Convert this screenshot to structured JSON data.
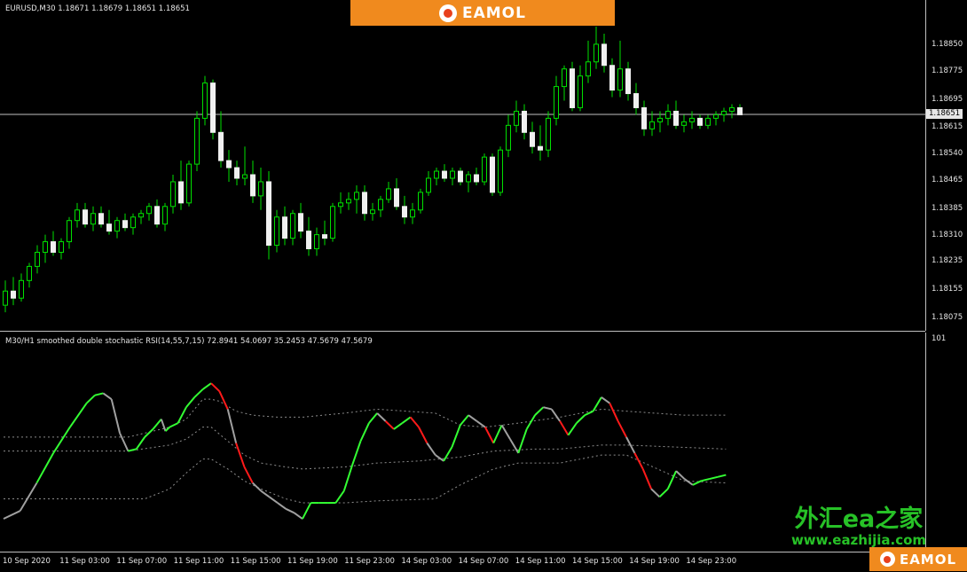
{
  "symbol_header": "EURUSD,M30  1.18671 1.18679 1.18651 1.18651",
  "indicator_header": "M30/H1 smoothed double stochastic RSI(14,55,7,15) 72.8941 54.0697 35.2453 47.5679 47.5679",
  "price_axis": {
    "ticks": [
      "1.18850",
      "1.18775",
      "1.18695",
      "1.18615",
      "1.18540",
      "1.18465",
      "1.18385",
      "1.18310",
      "1.18235",
      "1.18155",
      "1.18075"
    ],
    "current_price": "1.18651"
  },
  "indicator_axis": {
    "top_label": "101"
  },
  "time_axis": {
    "labels": [
      "10 Sep 2020",
      "11 Sep 03:00",
      "11 Sep 07:00",
      "11 Sep 11:00",
      "11 Sep 15:00",
      "11 Sep 19:00",
      "11 Sep 23:00",
      "14 Sep 03:00",
      "14 Sep 07:00",
      "14 Sep 11:00",
      "14 Sep 15:00",
      "14 Sep 19:00",
      "14 Sep 23:00"
    ]
  },
  "brand": {
    "top": "EAMOL",
    "bottom": "EAMOL"
  },
  "watermark": {
    "cn": "外汇ea之家",
    "url": "www.eazhijia.com"
  },
  "colors": {
    "bull": "#00e000",
    "bear": "#f0f0f0",
    "rising": "#33ff33",
    "falling": "#ff1a1a",
    "neutral": "#a0a0a0",
    "band": "#8c8c8c",
    "brand": "#f08a1e"
  },
  "chart_data": [
    {
      "type": "candlestick",
      "title": "EURUSD,M30",
      "ylim": [
        1.1805,
        1.189
      ],
      "candles": [
        [
          1.1811,
          1.1818,
          1.1809,
          1.1815
        ],
        [
          1.1815,
          1.1819,
          1.1811,
          1.1813
        ],
        [
          1.1813,
          1.182,
          1.1812,
          1.1818
        ],
        [
          1.1818,
          1.1823,
          1.1816,
          1.1822
        ],
        [
          1.1822,
          1.1828,
          1.182,
          1.1826
        ],
        [
          1.1826,
          1.1831,
          1.1823,
          1.1829
        ],
        [
          1.1829,
          1.1832,
          1.1825,
          1.1826
        ],
        [
          1.1826,
          1.183,
          1.1824,
          1.1829
        ],
        [
          1.1829,
          1.1836,
          1.1827,
          1.1835
        ],
        [
          1.1835,
          1.184,
          1.1833,
          1.1838
        ],
        [
          1.1838,
          1.184,
          1.1833,
          1.1834
        ],
        [
          1.1834,
          1.1839,
          1.1832,
          1.1837
        ],
        [
          1.1837,
          1.1839,
          1.1833,
          1.1834
        ],
        [
          1.1834,
          1.1838,
          1.1831,
          1.1832
        ],
        [
          1.1832,
          1.1836,
          1.183,
          1.1835
        ],
        [
          1.1835,
          1.1837,
          1.1832,
          1.1833
        ],
        [
          1.1833,
          1.1837,
          1.1831,
          1.1836
        ],
        [
          1.1836,
          1.1838,
          1.1834,
          1.1837
        ],
        [
          1.1837,
          1.184,
          1.1835,
          1.1839
        ],
        [
          1.1839,
          1.1841,
          1.1833,
          1.1834
        ],
        [
          1.1834,
          1.184,
          1.1832,
          1.1839
        ],
        [
          1.1839,
          1.1848,
          1.1837,
          1.1846
        ],
        [
          1.1846,
          1.1852,
          1.1838,
          1.184
        ],
        [
          1.184,
          1.1852,
          1.1839,
          1.1851
        ],
        [
          1.1851,
          1.1866,
          1.1849,
          1.1864
        ],
        [
          1.1864,
          1.1876,
          1.1862,
          1.1874
        ],
        [
          1.1874,
          1.1875,
          1.1858,
          1.186
        ],
        [
          1.186,
          1.1866,
          1.185,
          1.1852
        ],
        [
          1.1852,
          1.1855,
          1.1846,
          1.185
        ],
        [
          1.185,
          1.1852,
          1.1845,
          1.1847
        ],
        [
          1.1847,
          1.1856,
          1.1845,
          1.1848
        ],
        [
          1.1848,
          1.1852,
          1.184,
          1.1842
        ],
        [
          1.1842,
          1.185,
          1.1838,
          1.1846
        ],
        [
          1.1846,
          1.1849,
          1.1824,
          1.1828
        ],
        [
          1.1828,
          1.1838,
          1.1826,
          1.1836
        ],
        [
          1.1836,
          1.1839,
          1.1828,
          1.183
        ],
        [
          1.183,
          1.1838,
          1.1828,
          1.1837
        ],
        [
          1.1837,
          1.184,
          1.183,
          1.1832
        ],
        [
          1.1832,
          1.1836,
          1.1825,
          1.1827
        ],
        [
          1.1827,
          1.1833,
          1.1825,
          1.1831
        ],
        [
          1.1831,
          1.1835,
          1.1828,
          1.183
        ],
        [
          1.183,
          1.184,
          1.1829,
          1.1839
        ],
        [
          1.1839,
          1.1843,
          1.1837,
          1.184
        ],
        [
          1.184,
          1.1843,
          1.1838,
          1.1841
        ],
        [
          1.1841,
          1.1845,
          1.1837,
          1.1843
        ],
        [
          1.1843,
          1.1845,
          1.1835,
          1.1837
        ],
        [
          1.1837,
          1.184,
          1.1835,
          1.1838
        ],
        [
          1.1838,
          1.1842,
          1.1836,
          1.1841
        ],
        [
          1.1841,
          1.1846,
          1.184,
          1.1844
        ],
        [
          1.1844,
          1.1847,
          1.1838,
          1.1839
        ],
        [
          1.1839,
          1.1842,
          1.1834,
          1.1836
        ],
        [
          1.1836,
          1.184,
          1.1834,
          1.1838
        ],
        [
          1.1838,
          1.1844,
          1.1837,
          1.1843
        ],
        [
          1.1843,
          1.1849,
          1.1842,
          1.1847
        ],
        [
          1.1847,
          1.185,
          1.1845,
          1.1849
        ],
        [
          1.1849,
          1.1851,
          1.1846,
          1.1847
        ],
        [
          1.1847,
          1.185,
          1.1845,
          1.1849
        ],
        [
          1.1849,
          1.185,
          1.1845,
          1.1846
        ],
        [
          1.1846,
          1.1849,
          1.1843,
          1.1848
        ],
        [
          1.1848,
          1.185,
          1.1845,
          1.1846
        ],
        [
          1.1846,
          1.1854,
          1.1845,
          1.1853
        ],
        [
          1.1853,
          1.1854,
          1.1842,
          1.1843
        ],
        [
          1.1843,
          1.1856,
          1.1842,
          1.1855
        ],
        [
          1.1855,
          1.1865,
          1.1853,
          1.1862
        ],
        [
          1.1862,
          1.1869,
          1.186,
          1.1866
        ],
        [
          1.1866,
          1.1868,
          1.1858,
          1.186
        ],
        [
          1.186,
          1.1863,
          1.1854,
          1.1856
        ],
        [
          1.1856,
          1.1862,
          1.1852,
          1.1855
        ],
        [
          1.1855,
          1.1866,
          1.1853,
          1.1864
        ],
        [
          1.1864,
          1.1876,
          1.1862,
          1.1873
        ],
        [
          1.1873,
          1.1879,
          1.1869,
          1.1878
        ],
        [
          1.1878,
          1.188,
          1.1866,
          1.1867
        ],
        [
          1.1867,
          1.1879,
          1.1866,
          1.1876
        ],
        [
          1.1876,
          1.1886,
          1.1874,
          1.188
        ],
        [
          1.188,
          1.189,
          1.1878,
          1.1885
        ],
        [
          1.1885,
          1.1888,
          1.1877,
          1.1879
        ],
        [
          1.1879,
          1.1881,
          1.187,
          1.1872
        ],
        [
          1.1872,
          1.1886,
          1.187,
          1.1878
        ],
        [
          1.1878,
          1.188,
          1.1869,
          1.1871
        ],
        [
          1.1871,
          1.1874,
          1.1865,
          1.1867
        ],
        [
          1.1867,
          1.1869,
          1.1859,
          1.1861
        ],
        [
          1.1861,
          1.1866,
          1.1859,
          1.1863
        ],
        [
          1.1863,
          1.1866,
          1.186,
          1.1864
        ],
        [
          1.1864,
          1.1868,
          1.1862,
          1.1866
        ],
        [
          1.1866,
          1.1869,
          1.1861,
          1.1862
        ],
        [
          1.1862,
          1.1865,
          1.186,
          1.1863
        ],
        [
          1.1863,
          1.1866,
          1.1861,
          1.1864
        ],
        [
          1.1864,
          1.1865,
          1.1861,
          1.1862
        ],
        [
          1.1862,
          1.1865,
          1.1861,
          1.1864
        ],
        [
          1.1864,
          1.1866,
          1.1862,
          1.1865
        ],
        [
          1.1865,
          1.1867,
          1.1863,
          1.1866
        ],
        [
          1.1866,
          1.1868,
          1.1864,
          1.1867
        ],
        [
          1.1867,
          1.1868,
          1.1865,
          1.1865
        ]
      ]
    },
    {
      "type": "line",
      "title": "M30/H1 smoothed double stochastic RSI(14,55,7,15)",
      "ylim": [
        0,
        101
      ],
      "series": [
        {
          "points": [
            [
              0,
              12
            ],
            [
              4,
              16
            ],
            [
              8,
              30
            ],
            [
              12,
              45
            ],
            [
              16,
              58
            ],
            [
              20,
              70
            ],
            [
              22,
              74
            ],
            [
              24,
              75
            ],
            [
              26,
              72
            ],
            [
              28,
              55
            ],
            [
              30,
              46
            ],
            [
              32,
              47
            ],
            [
              34,
              53
            ],
            [
              36,
              57
            ],
            [
              38,
              62
            ],
            [
              39,
              56
            ],
            [
              40,
              58
            ],
            [
              42,
              60
            ],
            [
              44,
              68
            ],
            [
              46,
              73
            ],
            [
              48,
              77
            ],
            [
              50,
              80
            ],
            [
              52,
              76
            ],
            [
              54,
              67
            ],
            [
              56,
              50
            ],
            [
              58,
              38
            ],
            [
              60,
              30
            ],
            [
              62,
              26
            ],
            [
              64,
              23
            ],
            [
              66,
              20
            ],
            [
              68,
              17
            ],
            [
              70,
              15
            ],
            [
              72,
              12
            ],
            [
              74,
              20
            ],
            [
              76,
              20
            ],
            [
              78,
              20
            ],
            [
              80,
              20
            ],
            [
              82,
              26
            ],
            [
              84,
              39
            ],
            [
              86,
              51
            ],
            [
              88,
              60
            ],
            [
              90,
              65
            ],
            [
              92,
              61
            ],
            [
              94,
              57
            ],
            [
              96,
              60
            ],
            [
              98,
              63
            ],
            [
              100,
              58
            ],
            [
              102,
              50
            ],
            [
              104,
              44
            ],
            [
              106,
              41
            ],
            [
              108,
              48
            ],
            [
              110,
              59
            ],
            [
              112,
              64
            ],
            [
              114,
              61
            ],
            [
              116,
              58
            ],
            [
              118,
              50
            ],
            [
              120,
              59
            ],
            [
              122,
              52
            ],
            [
              124,
              45
            ],
            [
              126,
              57
            ],
            [
              128,
              64
            ],
            [
              130,
              68
            ],
            [
              132,
              67
            ],
            [
              134,
              61
            ],
            [
              136,
              54
            ],
            [
              138,
              60
            ],
            [
              140,
              64
            ],
            [
              142,
              66
            ],
            [
              144,
              73
            ],
            [
              146,
              70
            ],
            [
              148,
              61
            ],
            [
              150,
              53
            ],
            [
              152,
              45
            ],
            [
              154,
              37
            ],
            [
              156,
              27
            ],
            [
              158,
              23
            ],
            [
              160,
              27
            ],
            [
              162,
              36
            ],
            [
              164,
              32
            ],
            [
              166,
              29
            ],
            [
              168,
              31
            ],
            [
              170,
              32
            ],
            [
              172,
              33
            ],
            [
              174,
              34
            ]
          ],
          "ups": [
            1,
            0,
            1,
            0,
            1,
            0,
            1,
            0,
            1,
            0
          ]
        }
      ],
      "bands": {
        "upper": [
          [
            0,
            53
          ],
          [
            2,
            53
          ],
          [
            4,
            53
          ],
          [
            30,
            53
          ],
          [
            40,
            58
          ],
          [
            44,
            62
          ],
          [
            48,
            72
          ],
          [
            50,
            72
          ],
          [
            52,
            71
          ],
          [
            56,
            66
          ],
          [
            60,
            64
          ],
          [
            66,
            63
          ],
          [
            72,
            63
          ],
          [
            82,
            65
          ],
          [
            90,
            67
          ],
          [
            104,
            65
          ],
          [
            110,
            59
          ],
          [
            116,
            58
          ],
          [
            124,
            60
          ],
          [
            134,
            63
          ],
          [
            144,
            67
          ],
          [
            150,
            66
          ],
          [
            164,
            64
          ],
          [
            174,
            64
          ]
        ],
        "middle": [
          [
            0,
            46
          ],
          [
            30,
            46
          ],
          [
            40,
            49
          ],
          [
            44,
            52
          ],
          [
            48,
            58
          ],
          [
            50,
            58
          ],
          [
            54,
            51
          ],
          [
            58,
            44
          ],
          [
            62,
            40
          ],
          [
            68,
            38
          ],
          [
            72,
            37
          ],
          [
            82,
            38
          ],
          [
            90,
            40
          ],
          [
            100,
            41
          ],
          [
            110,
            43
          ],
          [
            118,
            46
          ],
          [
            128,
            47
          ],
          [
            134,
            47
          ],
          [
            144,
            49
          ],
          [
            150,
            49
          ],
          [
            174,
            47
          ]
        ],
        "lower": [
          [
            0,
            22
          ],
          [
            34,
            22
          ],
          [
            40,
            27
          ],
          [
            44,
            35
          ],
          [
            48,
            42
          ],
          [
            50,
            42
          ],
          [
            54,
            37
          ],
          [
            58,
            31
          ],
          [
            62,
            27
          ],
          [
            68,
            22
          ],
          [
            72,
            20
          ],
          [
            82,
            20
          ],
          [
            90,
            21
          ],
          [
            104,
            22
          ],
          [
            110,
            29
          ],
          [
            118,
            37
          ],
          [
            124,
            40
          ],
          [
            134,
            40
          ],
          [
            144,
            44
          ],
          [
            150,
            44
          ],
          [
            164,
            31
          ],
          [
            174,
            30
          ]
        ]
      }
    }
  ]
}
